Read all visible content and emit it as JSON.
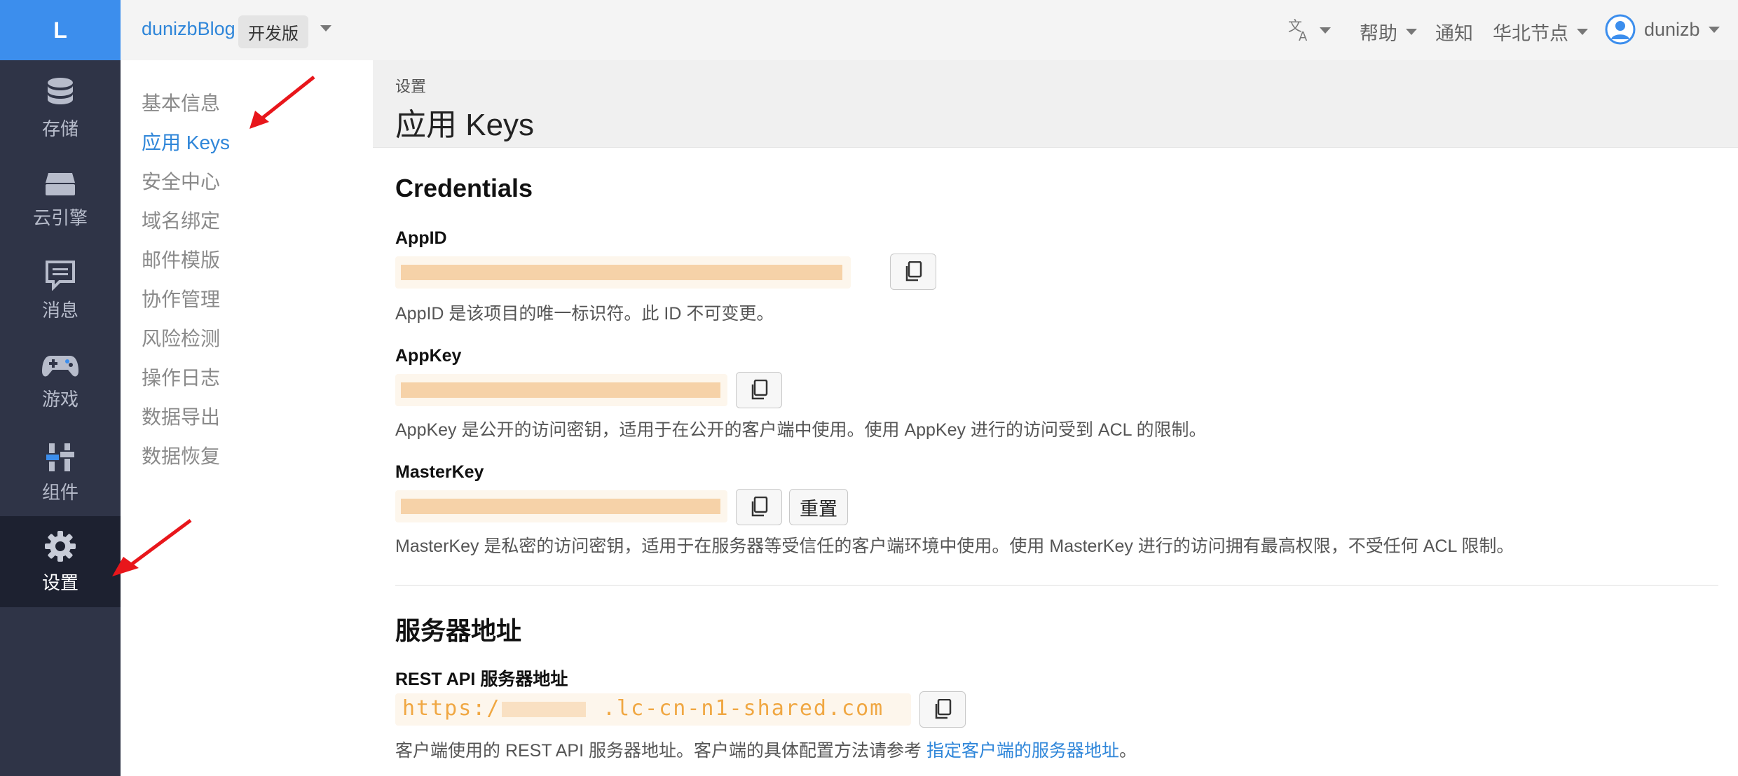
{
  "logo": "L",
  "rail": [
    {
      "label": "存储",
      "icon": "database-icon"
    },
    {
      "label": "云引擎",
      "icon": "server-icon"
    },
    {
      "label": "消息",
      "icon": "message-icon"
    },
    {
      "label": "游戏",
      "icon": "gamepad-icon"
    },
    {
      "label": "组件",
      "icon": "components-icon"
    },
    {
      "label": "设置",
      "icon": "gear-icon",
      "active": true
    }
  ],
  "topbar": {
    "app_name": "dunizbBlog",
    "env": "开发版",
    "links": {
      "help": "帮助",
      "notify": "通知",
      "region": "华北节点",
      "user": "dunizb"
    },
    "language_icon": "translate-icon"
  },
  "subnav": [
    "基本信息",
    "应用 Keys",
    "安全中心",
    "域名绑定",
    "邮件模版",
    "协作管理",
    "风险检测",
    "操作日志",
    "数据导出",
    "数据恢复"
  ],
  "subnav_active": "应用 Keys",
  "main": {
    "breadcrumb": "设置",
    "title": "应用 Keys",
    "credentials": {
      "heading": "Credentials",
      "appid": {
        "label": "AppID",
        "desc": "AppID 是该项目的唯一标识符。此 ID 不可变更。"
      },
      "appkey": {
        "label": "AppKey",
        "desc": "AppKey 是公开的访问密钥，适用于在公开的客户端中使用。使用 AppKey 进行的访问受到 ACL 的限制。"
      },
      "masterkey": {
        "label": "MasterKey",
        "reset": "重置",
        "desc": "MasterKey 是私密的访问密钥，适用于在服务器等受信任的客户端环境中使用。使用 MasterKey 进行的访问拥有最高权限，不受任何 ACL 限制。"
      }
    },
    "server": {
      "heading": "服务器地址",
      "rest_label": "REST API 服务器地址",
      "rest_prefix": "https:/",
      "rest_suffix": ".lc-cn-n1-shared.com",
      "desc": "客户端使用的 REST API 服务器地址。客户端的具体配置方法请参考 ",
      "link": "指定客户端的服务器地址",
      "desc_end": "。"
    }
  },
  "colors": {
    "accent": "#2f86d9",
    "rail_bg": "#2f3447",
    "logo_bg": "#3c8eed",
    "key_text": "#f0a742",
    "arrow": "#e8161b"
  }
}
